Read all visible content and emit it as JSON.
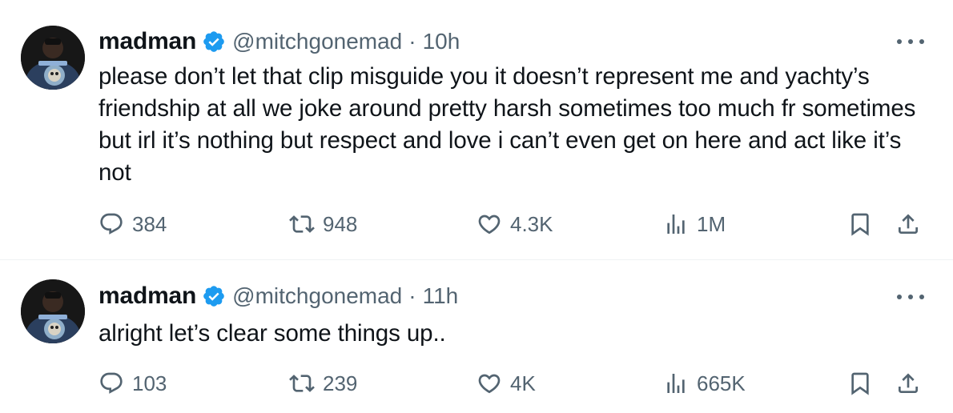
{
  "tweets": [
    {
      "name": "madman",
      "handle": "@mitchgonemad",
      "separator": "·",
      "time": "10h",
      "text": "please don’t let that clip misguide you it doesn’t represent me and yachty’s friendship at all we joke around pretty harsh sometimes too much fr sometimes but irl it’s nothing but respect and love i can’t even get on here and act like it’s not",
      "replies": "384",
      "reposts": "948",
      "likes": "4.3K",
      "views": "1M"
    },
    {
      "name": "madman",
      "handle": "@mitchgonemad",
      "separator": "·",
      "time": "11h",
      "text": "alright let’s clear some things up..",
      "replies": "103",
      "reposts": "239",
      "likes": "4K",
      "views": "665K"
    }
  ],
  "colors": {
    "verified": "#1d9bf0",
    "secondary_text": "#536471",
    "primary_text": "#0f1419",
    "divider": "#eff3f4"
  },
  "icons": [
    "verified-badge-icon",
    "more-icon",
    "reply-icon",
    "repost-icon",
    "like-icon",
    "views-icon",
    "bookmark-icon",
    "share-icon"
  ]
}
